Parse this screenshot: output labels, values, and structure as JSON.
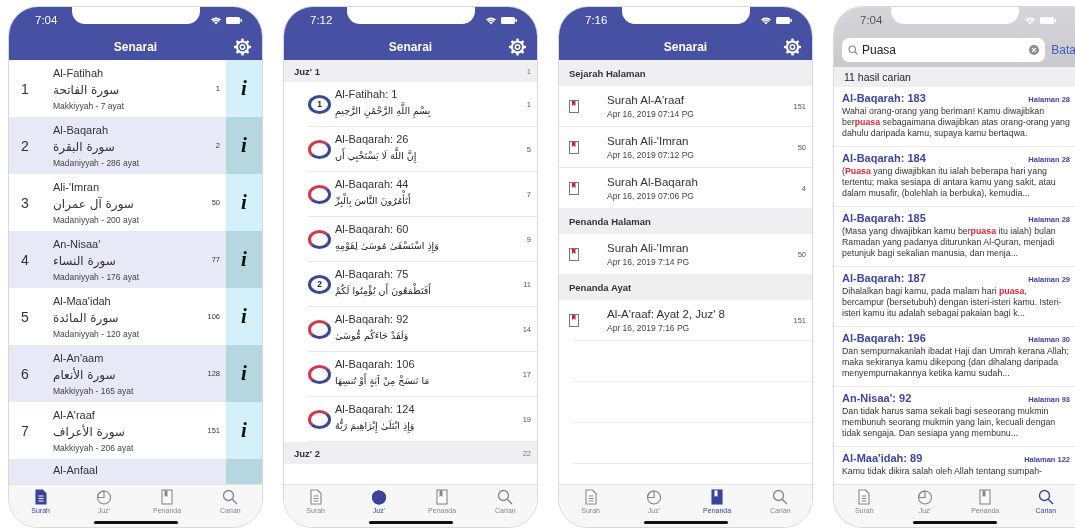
{
  "phones": [
    {
      "kind": "surah",
      "status_bar": {
        "time": "7:04"
      },
      "header": {
        "title": "Senarai"
      },
      "surahs": [
        {
          "number": "1",
          "name": "Al-Fatihah",
          "arabic": "سورة الفاتحة",
          "details": "Makkiyyah - 7 ayat",
          "page": "1",
          "info": "i"
        },
        {
          "number": "2",
          "name": "Al-Baqarah",
          "arabic": "سورة البقرة",
          "details": "Madaniyyah - 286 ayat",
          "page": "2",
          "info": "i"
        },
        {
          "number": "3",
          "name": "Ali-'Imran",
          "arabic": "سورة آل عمران",
          "details": "Madaniyyah - 200 ayat",
          "page": "50",
          "info": "i"
        },
        {
          "number": "4",
          "name": "An-Nisaa'",
          "arabic": "سورة النساء",
          "details": "Madaniyyah - 176 ayat",
          "page": "77",
          "info": "i"
        },
        {
          "number": "5",
          "name": "Al-Maa'idah",
          "arabic": "سورة المائدة",
          "details": "Madaniyyah - 120 ayat",
          "page": "106",
          "info": "i"
        },
        {
          "number": "6",
          "name": "Al-An'aam",
          "arabic": "سورة الأنعام",
          "details": "Makkiyyah - 165 ayat",
          "page": "128",
          "info": "i"
        },
        {
          "number": "7",
          "name": "Al-A'raaf",
          "arabic": "سورة الأعراف",
          "details": "Makkiyyah - 206 ayat",
          "page": "151",
          "info": "i"
        },
        {
          "name": "Al-Anfaal"
        }
      ],
      "tabs": [
        {
          "kind": "document",
          "label": "Surah",
          "selected": true
        },
        {
          "kind": "pie",
          "label": "Juz'",
          "selected": false
        },
        {
          "kind": "bookmark",
          "label": "Penanda",
          "selected": false
        },
        {
          "kind": "search",
          "label": "Carian",
          "selected": false
        }
      ]
    },
    {
      "kind": "juz",
      "status_bar": {
        "time": "7:12"
      },
      "header": {
        "title": "Senarai"
      },
      "sections": [
        {
          "title": "Juz' 1",
          "page": "1",
          "entries": [
            {
              "title": "Al-Fatihah: 1",
              "arabic": "بِسْمِ اللَّهِ الرَّحْمَٰنِ الرَّحِيمِ",
              "page": "1",
              "badge": "1"
            },
            {
              "title": "Al-Baqarah: 26",
              "arabic": "إِنَّ اللَّهَ لَا يَسْتَحْيِي أَن",
              "page": "5"
            },
            {
              "title": "Al-Baqarah: 44",
              "arabic": "أَتَأْمُرُونَ النَّاسَ بِالْبِرِّ",
              "page": "7"
            },
            {
              "title": "Al-Baqarah: 60",
              "arabic": "وَإِذِ اسْتَسْقَىٰ مُوسَىٰ لِقَوْمِهِ",
              "page": "9"
            },
            {
              "title": "Al-Baqarah: 75",
              "arabic": "أَفَتَطْمَعُونَ أَن يُؤْمِنُوا لَكُمْ",
              "page": "11",
              "badge": "2"
            },
            {
              "title": "Al-Baqarah: 92",
              "arabic": "وَلَقَدْ جَاءَكُم مُّوسَىٰ",
              "page": "14"
            },
            {
              "title": "Al-Baqarah: 106",
              "arabic": "مَا نَنسَخْ مِنْ آيَةٍ أَوْ نُنسِهَا",
              "page": "17"
            },
            {
              "title": "Al-Baqarah: 124",
              "arabic": "وَإِذِ ابْتَلَىٰ إِبْرَاهِيمَ رَبُّهُ",
              "page": "19"
            }
          ]
        },
        {
          "title": "Juz' 2",
          "page": "22"
        }
      ],
      "tabs": [
        {
          "kind": "document",
          "label": "Surah",
          "selected": false
        },
        {
          "kind": "pie",
          "label": "Juz'",
          "selected": true
        },
        {
          "kind": "bookmark",
          "label": "Penanda",
          "selected": false
        },
        {
          "kind": "search",
          "label": "Carian",
          "selected": false
        }
      ]
    },
    {
      "kind": "bookmarks",
      "status_bar": {
        "time": "7:16"
      },
      "header": {
        "title": "Senarai"
      },
      "sections": [
        {
          "title": "Sejarah Halaman",
          "entries": [
            {
              "title": "Surah Al-A'raaf",
              "date": "Apr 16, 2019 07:14 PG",
              "page": "151"
            },
            {
              "title": "Surah Ali-'Imran",
              "date": "Apr 16, 2019 07:12 PG",
              "page": "50"
            },
            {
              "title": "Surah Al-Baqarah",
              "date": "Apr 16, 2019 07:06 PG",
              "page": "4"
            }
          ]
        },
        {
          "title": "Penanda Halaman",
          "entries": [
            {
              "title": "Surah Ali-'Imran",
              "date": "Apr 16, 2019 7:14 PG",
              "page": "50"
            }
          ]
        },
        {
          "title": "Penanda Ayat",
          "entries": [
            {
              "title": "Al-A'raaf: Ayat 2, Juz' 8",
              "date": "Apr 16, 2019 7:16 PG",
              "page": "151"
            }
          ]
        }
      ],
      "tabs": [
        {
          "kind": "document",
          "label": "Surah",
          "selected": false
        },
        {
          "kind": "pie",
          "label": "Juz'",
          "selected": false
        },
        {
          "kind": "bookmark",
          "label": "Penanda",
          "selected": true
        },
        {
          "kind": "search",
          "label": "Carian",
          "selected": false
        }
      ]
    },
    {
      "kind": "search",
      "status_bar": {
        "time": "7:04"
      },
      "search": {
        "value": "Puasa",
        "cancel": "Bata"
      },
      "result_count": "11 hasil carian",
      "results": [
        {
          "reference": "Al-Baqarah: 183",
          "page": "Halaman 28",
          "snippet": "Wahai orang-orang yang beriman! Kamu diwajibkan ber**puasa** sebagaimana diwajibkan atas orang-orang yang dahulu daripada kamu, supaya kamu bertaqwa."
        },
        {
          "reference": "Al-Baqarah: 184",
          "page": "Halaman 28",
          "snippet": "(**Puasa** yang diwajibkan itu ialah beberapa hari yang tertentu; maka sesiapa di antara kamu yang sakit, atau dalam musafir, (bolehlah ia berbuka), kemudia..."
        },
        {
          "reference": "Al-Baqarah: 185",
          "page": "Halaman 28",
          "snippet": "(Masa yang diwajibkan kamu ber**puasa** itu ialah) bulan Ramadan yang padanya diturunkan Al-Quran, menjadi petunjuk bagi sekalian manusia, dan menja..."
        },
        {
          "reference": "Al-Baqarah: 187",
          "page": "Halaman 29",
          "snippet": "Dihalalkan bagi kamu, pada malam hari **puasa**, bercampur (bersetubuh) dengan isteri-isteri kamu. Isteri-isteri kamu itu adalah sebagai pakaian bagi k..."
        },
        {
          "reference": "Al-Baqarah: 196",
          "page": "Halaman 30",
          "snippet": "Dan sempurnakanlah ibadat Haji dan Umrah kerana Allah; maka sekiranya kamu dikepong (dan dihalang daripada menyempurnakannya ketika kamu sudah..."
        },
        {
          "reference": "An-Nisaa': 92",
          "page": "Halaman 93",
          "snippet": "Dan tidak harus sama sekali bagi seseorang mukmin membunuh seorang mukmin yang lain, kecuali dengan tidak sengaja. Dan sesiapa yang membunu..."
        },
        {
          "reference": "Al-Maa'idah: 89",
          "page": "Halaman 122",
          "snippet": "Kamu tidak dikira salah oleh Allah tentang sumpah-"
        }
      ],
      "tabs": [
        {
          "kind": "document",
          "label": "Surah",
          "selected": false
        },
        {
          "kind": "pie",
          "label": "Juz'",
          "selected": false
        },
        {
          "kind": "bookmark",
          "label": "Penanda",
          "selected": false
        },
        {
          "kind": "search",
          "label": "Carian",
          "selected": true
        }
      ]
    }
  ]
}
